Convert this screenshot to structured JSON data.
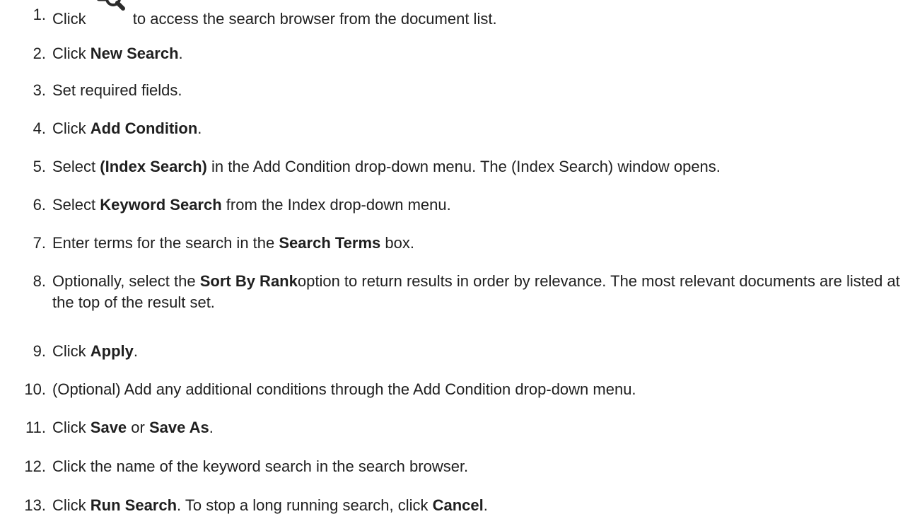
{
  "steps": [
    {
      "num": "1.",
      "parts": [
        {
          "t": "Click "
        },
        {
          "icon": "search-browser-icon"
        },
        {
          "t": "to access the search browser from the document list."
        }
      ]
    },
    {
      "num": "2.",
      "parts": [
        {
          "t": "Click "
        },
        {
          "t": "New Search",
          "b": true
        },
        {
          "t": "."
        }
      ]
    },
    {
      "num": "3.",
      "parts": [
        {
          "t": "Set required fields."
        }
      ]
    },
    {
      "num": "4.",
      "parts": [
        {
          "t": "Click "
        },
        {
          "t": "Add Condition",
          "b": true
        },
        {
          "t": "."
        }
      ]
    },
    {
      "num": "5.",
      "parts": [
        {
          "t": "Select "
        },
        {
          "t": "(Index Search)",
          "b": true
        },
        {
          "t": " in the Add Condition drop-down menu. The (Index Search) window opens."
        }
      ]
    },
    {
      "num": "6.",
      "parts": [
        {
          "t": "Select "
        },
        {
          "t": "Keyword Search",
          "b": true
        },
        {
          "t": " from the Index drop-down menu."
        }
      ]
    },
    {
      "num": "7.",
      "parts": [
        {
          "t": "Enter terms for the search in the "
        },
        {
          "t": "Search Terms",
          "b": true
        },
        {
          "t": " box."
        }
      ]
    },
    {
      "num": "8.",
      "parts": [
        {
          "t": "Optionally, select the "
        },
        {
          "t": "Sort By Rank",
          "b": true
        },
        {
          "t": "option to return results in order by relevance. The most relevant documents are listed at the top of the result set."
        }
      ]
    },
    {
      "num": "9.",
      "parts": [
        {
          "t": "Click "
        },
        {
          "t": "Apply",
          "b": true
        },
        {
          "t": "."
        }
      ]
    },
    {
      "num": "10.",
      "parts": [
        {
          "t": "(Optional) Add any additional conditions through the Add Condition drop-down menu."
        }
      ]
    },
    {
      "num": "11.",
      "parts": [
        {
          "t": "Click "
        },
        {
          "t": "Save",
          "b": true
        },
        {
          "t": " or "
        },
        {
          "t": "Save As",
          "b": true
        },
        {
          "t": "."
        }
      ]
    },
    {
      "num": "12.",
      "parts": [
        {
          "t": "Click the name of the keyword search in the search browser."
        }
      ]
    },
    {
      "num": "13.",
      "parts": [
        {
          "t": "Click "
        },
        {
          "t": "Run Search",
          "b": true
        },
        {
          "t": ". To stop a long running search, click "
        },
        {
          "t": "Cancel",
          "b": true
        },
        {
          "t": "."
        }
      ]
    }
  ]
}
